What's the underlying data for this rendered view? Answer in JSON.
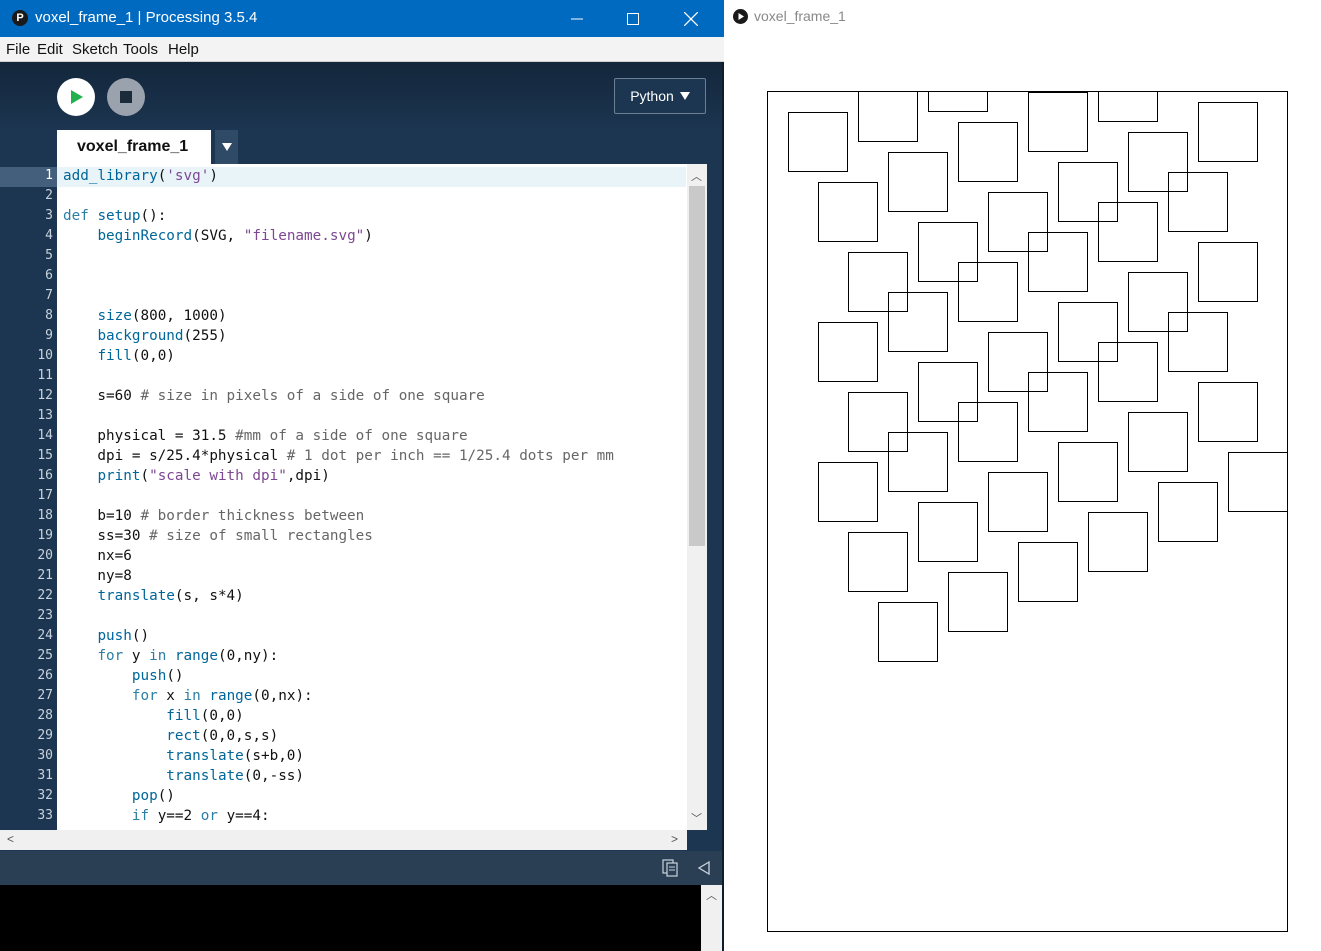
{
  "ide": {
    "window_title": "voxel_frame_1 | Processing 3.5.4",
    "app_icon_glyph": "P",
    "menu": [
      "File",
      "Edit",
      "Sketch",
      "Tools",
      "Help"
    ],
    "mode_label": "Python",
    "tab_label": "voxel_frame_1",
    "code": [
      "add_library('svg')",
      "",
      "def setup():",
      "    beginRecord(SVG, \"filename.svg\")",
      "",
      "",
      "",
      "    size(800, 1000)",
      "    background(255)",
      "    fill(0,0)",
      "",
      "    s=60 # size in pixels of a side of one square",
      "",
      "    physical = 31.5 #mm of a side of one square",
      "    dpi = s/25.4*physical # 1 dot per inch == 1/25.4 dots per mm",
      "    print(\"scale with dpi\",dpi)",
      "",
      "    b=10 # border thickness between",
      "    ss=30 # size of small rectangles",
      "    nx=6",
      "    ny=8",
      "    translate(s, s*4)",
      "",
      "    push()",
      "    for y in range(0,ny):",
      "        push()",
      "        for x in range(0,nx):",
      "            fill(0,0)",
      "            rect(0,0,s,s)",
      "            translate(s+b,0)",
      "            translate(0,-ss)",
      "        pop()",
      "        if y==2 or y==4:"
    ],
    "active_line": 1,
    "colors": {
      "titlebar": "#0069c0",
      "ide_background": "#1c3550",
      "keyword": "#2d7ea3",
      "string": "#7d4793",
      "comment": "#666666"
    },
    "icons": {
      "run": "play-icon",
      "stop": "stop-icon",
      "minimize": "minimize-icon",
      "maximize": "maximize-icon",
      "close": "close-icon",
      "tab_menu": "chevron-down-icon",
      "copy": "copy-icon",
      "collapse": "collapse-arrow-icon"
    }
  },
  "sketch": {
    "window_title": "voxel_frame_1",
    "grid": {
      "nx": 6,
      "ny": 8,
      "square": 60,
      "gap": 10,
      "shift": 30,
      "extra_shift_rows": [
        2,
        4
      ]
    }
  }
}
